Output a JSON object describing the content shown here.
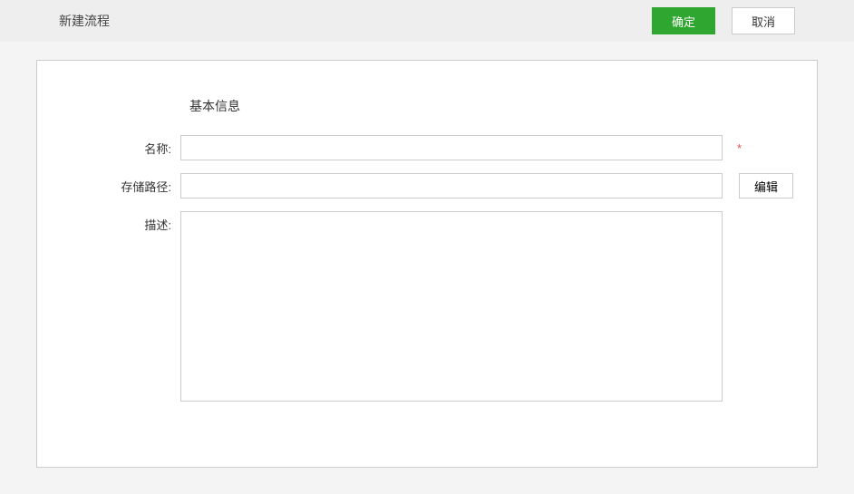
{
  "header": {
    "title": "新建流程",
    "confirm_label": "确定",
    "cancel_label": "取消"
  },
  "form": {
    "section_title": "基本信息",
    "name": {
      "label": "名称:",
      "value": "",
      "required_mark": "*"
    },
    "storage_path": {
      "label": "存储路径:",
      "value": "",
      "edit_button": "编辑"
    },
    "description": {
      "label": "描述:",
      "value": ""
    }
  }
}
